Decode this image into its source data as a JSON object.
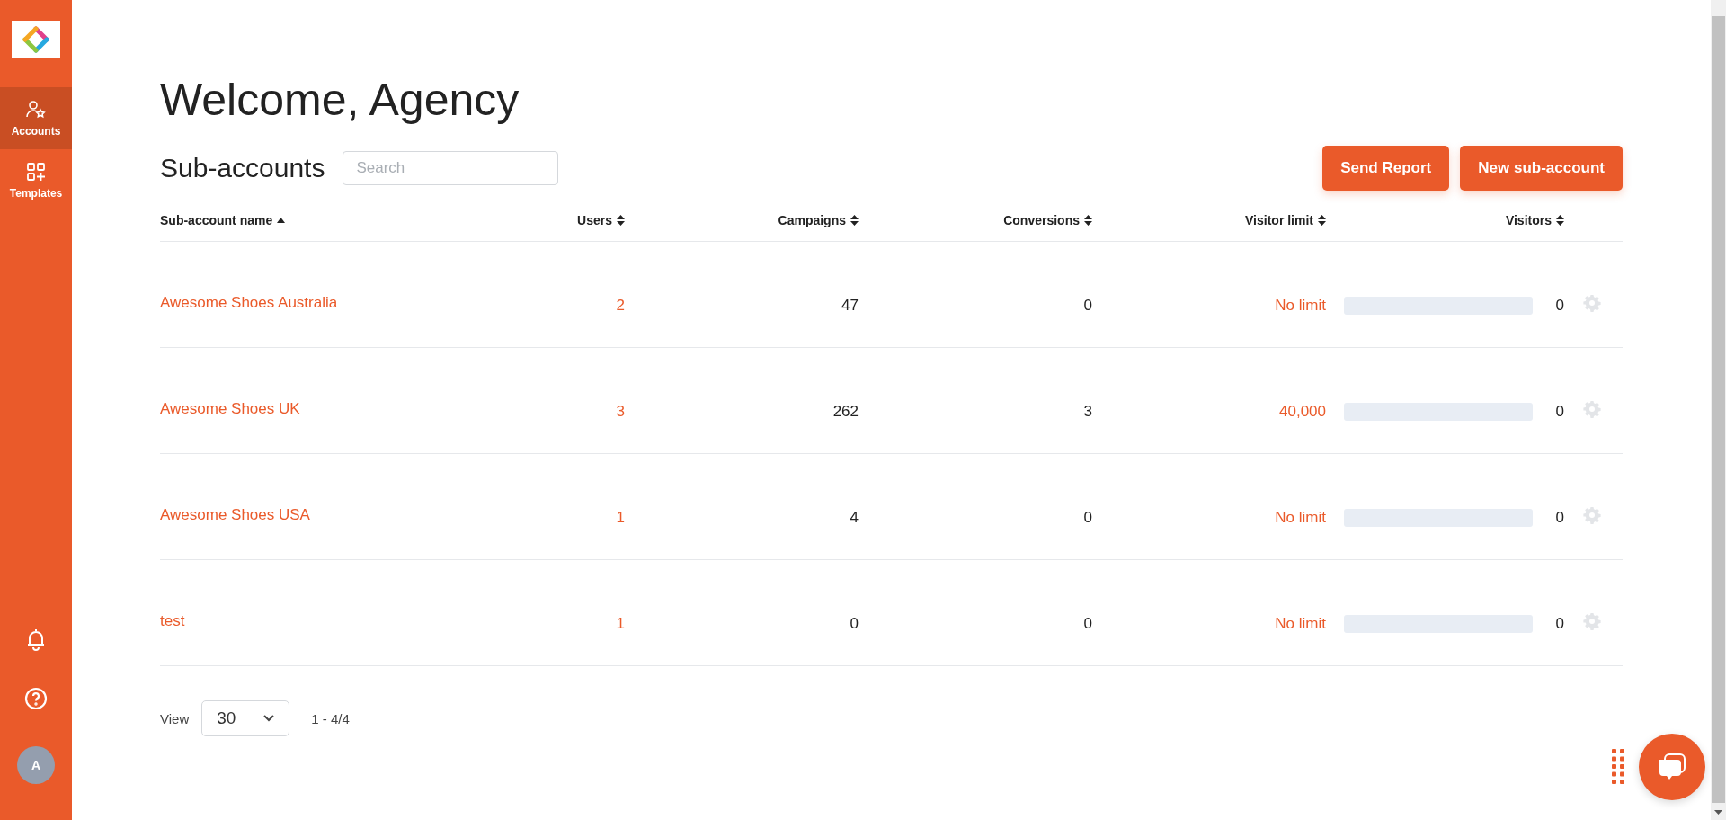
{
  "sidebar": {
    "items": [
      {
        "label": "Accounts",
        "selected": true
      },
      {
        "label": "Templates",
        "selected": false
      }
    ],
    "avatar": "A"
  },
  "heading": "Welcome, Agency",
  "section_title": "Sub-accounts",
  "search": {
    "placeholder": "Search"
  },
  "buttons": [
    "Send Report",
    "New sub-account"
  ],
  "table": {
    "columns": [
      {
        "label": "Sub-account name",
        "sorted": true
      },
      {
        "label": "Users",
        "sorted": false
      },
      {
        "label": "Campaigns",
        "sorted": false
      },
      {
        "label": "Conversions",
        "sorted": false
      },
      {
        "label": "Visitor limit",
        "sorted": false
      },
      {
        "label": "Visitors",
        "sorted": false
      }
    ],
    "rows": [
      {
        "name": "Awesome Shoes Australia",
        "users": "2",
        "campaigns": "47",
        "conversions": "0",
        "visitor_limit": "No limit",
        "level": 0,
        "visitors": "0"
      },
      {
        "name": "Awesome Shoes UK",
        "users": "3",
        "campaigns": "262",
        "conversions": "3",
        "visitor_limit": "40,000",
        "level": 0,
        "visitors": "0"
      },
      {
        "name": "Awesome Shoes USA",
        "users": "1",
        "campaigns": "4",
        "conversions": "0",
        "visitor_limit": "No limit",
        "level": 0,
        "visitors": "0"
      },
      {
        "name": "test",
        "users": "1",
        "campaigns": "0",
        "conversions": "0",
        "visitor_limit": "No limit",
        "level": 0,
        "visitors": "0"
      }
    ]
  },
  "pagination": {
    "label": "View",
    "page_size": "30",
    "range": "1 - 4/4"
  }
}
